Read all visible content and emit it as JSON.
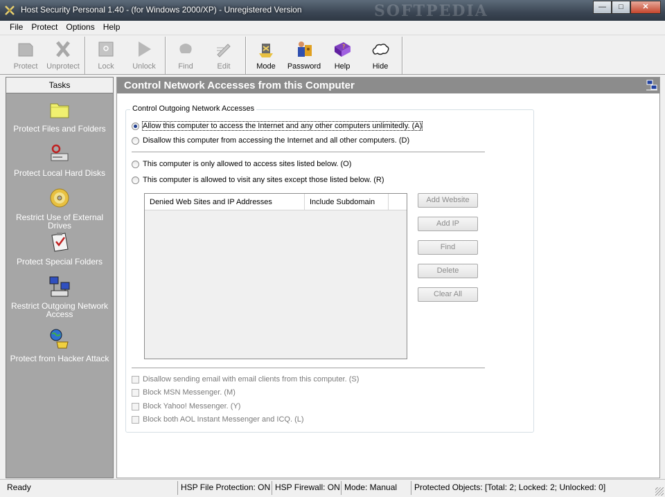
{
  "window": {
    "title": "Host Security Personal 1.40 - (for Windows 2000/XP) - Unregistered Version",
    "watermark": "SOFTPEDIA",
    "buttons": {
      "minimize": "—",
      "maximize": "□",
      "close": "✕"
    }
  },
  "menu": [
    "File",
    "Protect",
    "Options",
    "Help"
  ],
  "toolbar": {
    "items": [
      {
        "label": "Protect",
        "icon": "protect-icon",
        "enabled": false
      },
      {
        "label": "Unprotect",
        "icon": "unprotect-icon",
        "enabled": false
      },
      {
        "label": "Lock",
        "icon": "lock-icon",
        "enabled": false
      },
      {
        "label": "Unlock",
        "icon": "unlock-icon",
        "enabled": false
      },
      {
        "label": "Find",
        "icon": "find-icon",
        "enabled": false
      },
      {
        "label": "Edit",
        "icon": "edit-icon",
        "enabled": false
      },
      {
        "label": "Mode",
        "icon": "mode-icon",
        "enabled": true
      },
      {
        "label": "Password",
        "icon": "password-icon",
        "enabled": true
      },
      {
        "label": "Help",
        "icon": "help-book-icon",
        "enabled": true
      },
      {
        "label": "Hide",
        "icon": "cloud-hide-icon",
        "enabled": true
      }
    ]
  },
  "sidebar": {
    "header": "Tasks",
    "tasks": [
      {
        "label": "Protect Files and Folders",
        "icon": "folder-icon"
      },
      {
        "label": "Protect Local Hard Disks",
        "icon": "hard-disk-icon"
      },
      {
        "label": "Restrict Use of External Drives",
        "icon": "cd-drive-icon"
      },
      {
        "label": "Protect Special Folders",
        "icon": "checklist-icon"
      },
      {
        "label": "Restrict Outgoing Network Access",
        "icon": "network-computers-icon"
      },
      {
        "label": "Protect from Hacker Attack",
        "icon": "globe-phone-icon"
      }
    ]
  },
  "main": {
    "title": "Control Network Accesses from this Computer",
    "group_title": "Control Outgoing Network Accesses",
    "radios": [
      {
        "label": "Allow this computer to access the Internet and any other computers unlimitedly. (A)",
        "checked": true
      },
      {
        "label": "Disallow this computer from accessing the Internet and all other computers. (D)",
        "checked": false
      },
      {
        "label": "This computer is only allowed to access sites listed below. (O)",
        "checked": false
      },
      {
        "label": "This computer is allowed to visit any sites except those listed below. (R)",
        "checked": false
      }
    ],
    "list_columns": [
      "Denied Web Sites and IP Addresses",
      "Include Subdomain"
    ],
    "list_buttons": [
      "Add Website",
      "Add IP",
      "Find",
      "Delete",
      "Clear All"
    ],
    "checkboxes": [
      {
        "label": "Disallow sending email with email clients from this computer. (S)",
        "checked": false
      },
      {
        "label": "Block MSN Messenger. (M)",
        "checked": false
      },
      {
        "label": "Block Yahoo! Messenger. (Y)",
        "checked": false
      },
      {
        "label": "Block both AOL Instant Messenger and ICQ. (L)",
        "checked": false
      }
    ]
  },
  "status": {
    "ready": "Ready",
    "file_protection": "HSP File Protection: ON",
    "firewall": "HSP Firewall: ON",
    "mode": "Mode: Manual",
    "objects": "Protected Objects: [Total: 2; Locked: 2; Unlocked: 0]"
  }
}
